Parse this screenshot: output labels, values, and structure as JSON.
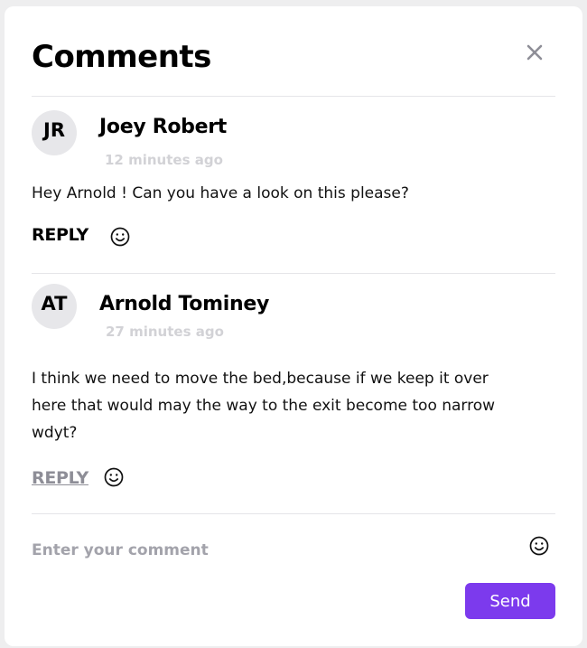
{
  "header": {
    "title": "Comments",
    "close_icon": "close-icon"
  },
  "comments": [
    {
      "initials": "JR",
      "author": "Joey Robert",
      "time": "12 minutes ago",
      "text": "Hey Arnold ! Can you have a look on this please?",
      "reply_label": "REPLY",
      "reply_state": "active",
      "emoji_icon": "smiley-icon"
    },
    {
      "initials": "AT",
      "author": "Arnold Tominey",
      "time": "27 minutes ago",
      "text": "I think we need to move the bed,because if we keep it over here that would may the way to the exit become too narrow wdyt?",
      "reply_label": "REPLY",
      "reply_state": "muted",
      "emoji_icon": "smiley-icon"
    }
  ],
  "composer": {
    "placeholder": "Enter your comment",
    "value": "",
    "emoji_icon": "smiley-icon",
    "send_label": "Send"
  },
  "colors": {
    "accent": "#7c3aed",
    "muted_text": "#8e8e97",
    "timestamp": "#d2d2d6",
    "avatar_bg": "#e7e7ea"
  }
}
